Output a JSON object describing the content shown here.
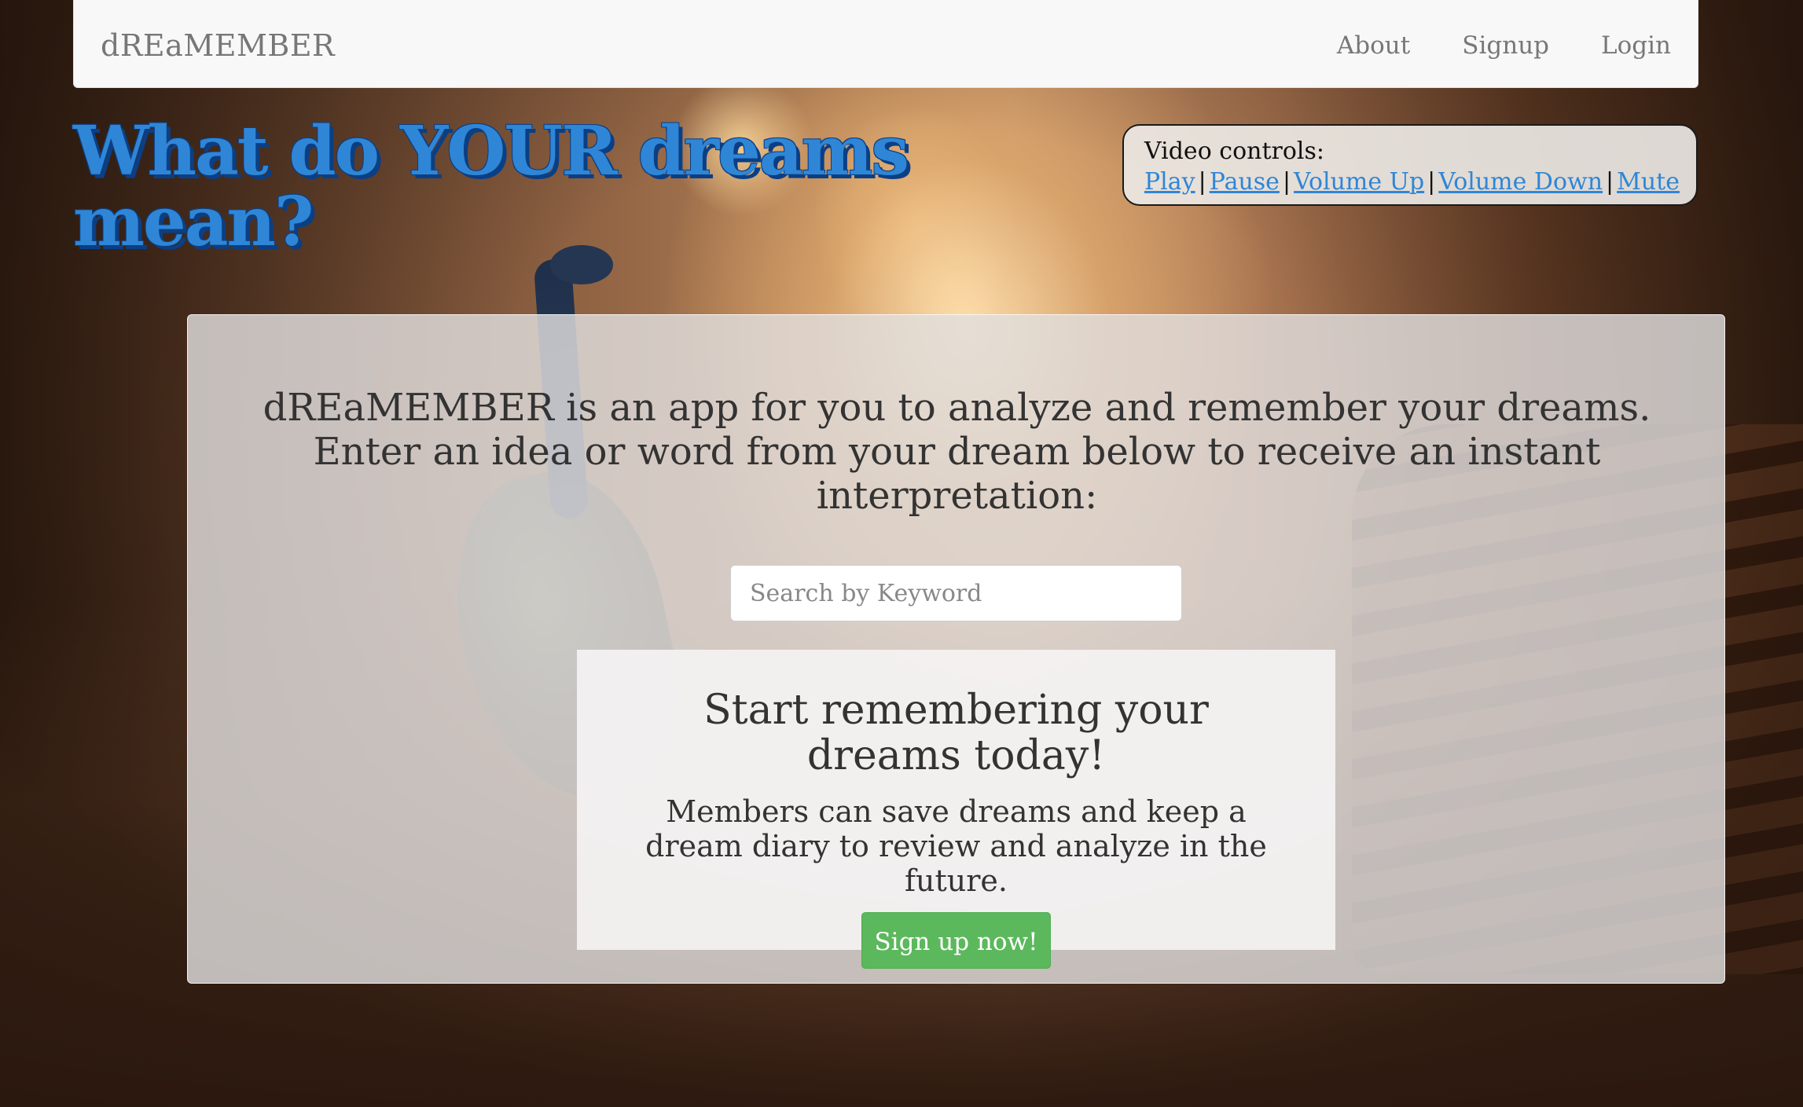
{
  "navbar": {
    "brand": "dREaMEMBER",
    "links": [
      {
        "label": "About"
      },
      {
        "label": "Signup"
      },
      {
        "label": "Login"
      }
    ]
  },
  "hero": {
    "headline": "What do YOUR dreams mean?"
  },
  "video_controls": {
    "title": "Video controls:",
    "links": {
      "play": "Play",
      "pause": "Pause",
      "volume_up": "Volume Up",
      "volume_down": "Volume Down",
      "mute": "Mute"
    },
    "separator": "|"
  },
  "main": {
    "intro": "dREaMEMBER is an app for you to analyze and remember your dreams. Enter an idea or word from your dream below to receive an instant interpretation:",
    "search": {
      "placeholder": "Search by Keyword",
      "value": ""
    },
    "cta": {
      "title": "Start remembering your dreams today!",
      "text": "Members can save dreams and keep a dream diary to review and analyze in the future.",
      "button": "Sign up now!"
    }
  },
  "colors": {
    "headline": "#2f86d6",
    "headline_shadow": "#0b3f85",
    "link": "#2f86d6",
    "button": "#5cb85c",
    "navbar_bg": "#f8f8f8"
  }
}
